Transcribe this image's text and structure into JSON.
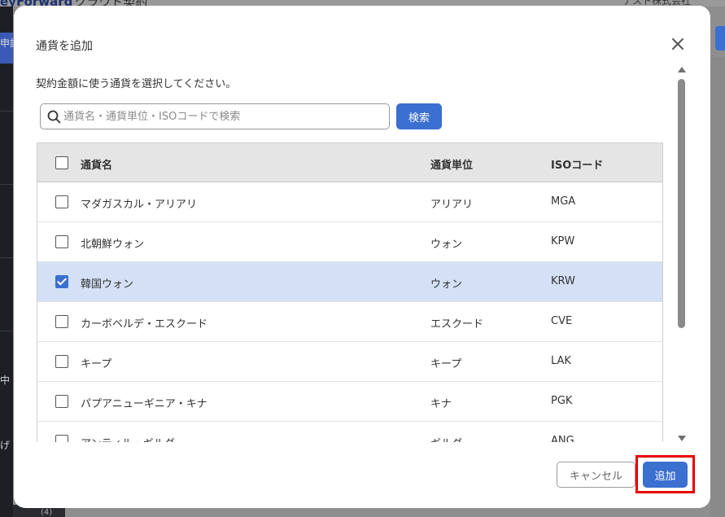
{
  "background": {
    "logo_bold": "eyForward",
    "logo_light": "クラウド契約",
    "company": "テスト株式会社",
    "sidebar_labels": [
      "申請",
      "中",
      "げ"
    ],
    "bottom_label": "(4)"
  },
  "modal": {
    "title": "通貨を追加",
    "description": "契約金額に使う通貨を選択してください。",
    "search_placeholder": "通貨名・通貨単位・ISOコードで検索",
    "search_button": "検索",
    "table": {
      "headers": {
        "name": "通貨名",
        "unit": "通貨単位",
        "iso": "ISOコード"
      },
      "rows": [
        {
          "name": "マダガスカル・アリアリ",
          "unit": "アリアリ",
          "iso": "MGA",
          "checked": false
        },
        {
          "name": "北朝鮮ウォン",
          "unit": "ウォン",
          "iso": "KPW",
          "checked": false
        },
        {
          "name": "韓国ウォン",
          "unit": "ウォン",
          "iso": "KRW",
          "checked": true
        },
        {
          "name": "カーボベルデ・エスクード",
          "unit": "エスクード",
          "iso": "CVE",
          "checked": false
        },
        {
          "name": "キープ",
          "unit": "キープ",
          "iso": "LAK",
          "checked": false
        },
        {
          "name": "パプアニューギニア・キナ",
          "unit": "キナ",
          "iso": "PGK",
          "checked": false
        },
        {
          "name": "アンティル・ギルダー",
          "unit": "ギルダー",
          "iso": "ANG",
          "checked": false
        }
      ]
    },
    "cancel_button": "キャンセル",
    "add_button": "追加"
  },
  "colors": {
    "accent": "#3b6fd0",
    "selected_row": "#d3e0f5",
    "highlight": "#e60000"
  }
}
